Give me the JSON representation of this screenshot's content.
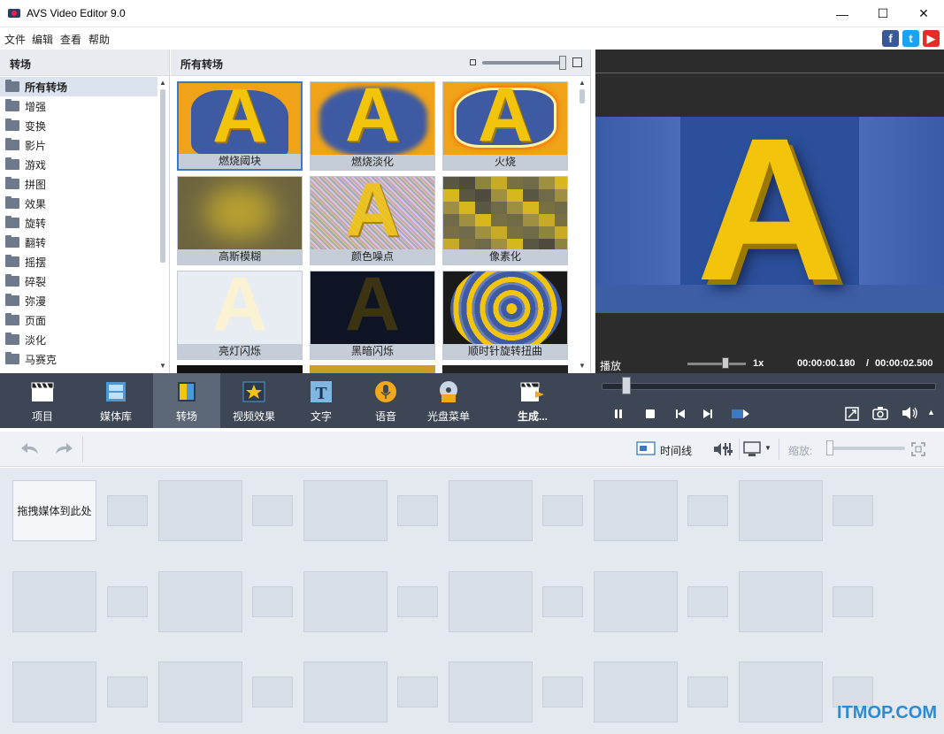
{
  "window": {
    "title": "AVS Video Editor 9.0",
    "minimize": "—",
    "maximize": "☐",
    "close": "✕"
  },
  "menu": [
    "文件",
    "编辑",
    "查看",
    "帮助"
  ],
  "social": [
    {
      "icon": "facebook-icon",
      "glyph": "f",
      "color": "#3b5998"
    },
    {
      "icon": "twitter-icon",
      "glyph": "t",
      "color": "#1da1f2"
    },
    {
      "icon": "youtube-icon",
      "glyph": "▶",
      "color": "#e52d27"
    }
  ],
  "left": {
    "header": "转场",
    "categories": [
      "所有转场",
      "增强",
      "变换",
      "影片",
      "游戏",
      "拼图",
      "效果",
      "旋转",
      "翻转",
      "摇摆",
      "碎裂",
      "弥漫",
      "页面",
      "淡化",
      "马赛克"
    ]
  },
  "middle": {
    "header": "所有转场",
    "tiles": [
      {
        "label": "燃烧阈块",
        "style": "burn"
      },
      {
        "label": "燃烧淡化",
        "style": "burnfade"
      },
      {
        "label": "火烧",
        "style": "fire"
      },
      {
        "label": "高斯模糊",
        "style": "blur"
      },
      {
        "label": "颜色噪点",
        "style": "noise"
      },
      {
        "label": "像素化",
        "style": "pixel"
      },
      {
        "label": "亮灯闪烁",
        "style": "light"
      },
      {
        "label": "黑暗闪烁",
        "style": "dark"
      },
      {
        "label": "顺时针旋转扭曲",
        "style": "swirl"
      }
    ]
  },
  "preview": {
    "letter": "A",
    "play_label": "播放",
    "speed": "1x",
    "current_time": "00:00:00.180",
    "separator": "/",
    "total_time": "00:00:02.500"
  },
  "toolbar": [
    {
      "label": "项目",
      "icon": "clapper-icon"
    },
    {
      "label": "媒体库",
      "icon": "film-icon"
    },
    {
      "label": "转场",
      "icon": "transition-icon"
    },
    {
      "label": "视频效果",
      "icon": "star-icon"
    },
    {
      "label": "文字",
      "icon": "text-icon"
    },
    {
      "label": "语音",
      "icon": "microphone-icon"
    },
    {
      "label": "光盘菜单",
      "icon": "disc-icon"
    },
    {
      "label": "生成...",
      "icon": "produce-icon"
    }
  ],
  "timeline": {
    "timeline_label": "时间线",
    "zoom_label": "缩放:"
  },
  "storyboard": {
    "drop_label": "拖拽媒体到此处"
  },
  "watermark": "ITMOP.COM",
  "colors": {
    "selection": "#3b79c4",
    "toolbar_bg": "#3d4654",
    "accent_yellow": "#f2c40c"
  }
}
